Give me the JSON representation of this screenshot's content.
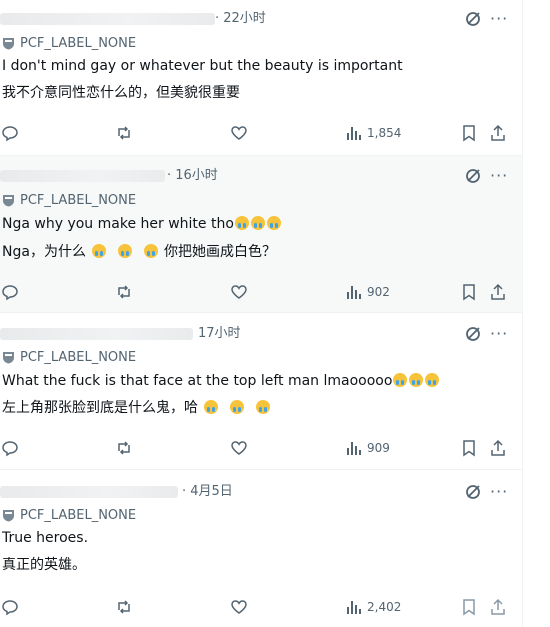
{
  "verified_label": "PCF_LABEL_NONE",
  "tweets": [
    {
      "time": "· 22小时",
      "line1": "I don't mind gay or whatever but the beauty is important",
      "line2": "我不介意同性恋什么的，但美貌很重要",
      "views": "1,854"
    },
    {
      "time": "· 16小时",
      "line1": "Nga why you make her white tho",
      "line2a": "Nga，为什么",
      "line2b": "你把她画成白色？",
      "views": "902"
    },
    {
      "time": "17小时",
      "line1": "What the fuck is that face at the top left man lmaooooo",
      "line2": "左上角那张脸到底是什么鬼，哈",
      "views": "909"
    },
    {
      "time": "· 4月5日",
      "line1": "True heroes.",
      "line2": "真正的英雄。",
      "views": "2,402"
    }
  ]
}
